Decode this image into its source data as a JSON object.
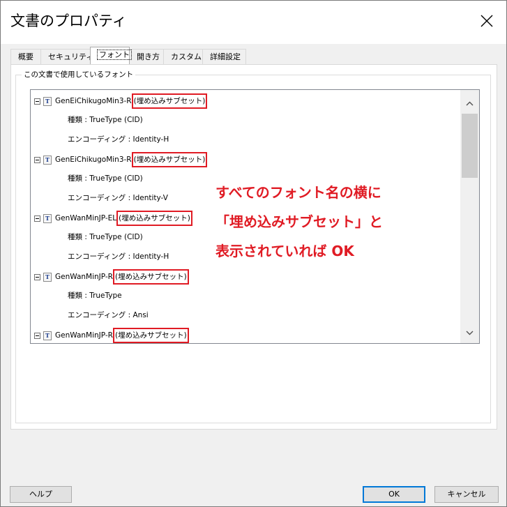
{
  "window": {
    "title": "文書のプロパティ"
  },
  "tabs": [
    {
      "label": "概要"
    },
    {
      "label": "セキュリティ"
    },
    {
      "label": "フォント",
      "active": true
    },
    {
      "label": "開き方"
    },
    {
      "label": "カスタム"
    },
    {
      "label": "詳細設定"
    }
  ],
  "group_label": "この文書で使用しているフォント",
  "fonts": [
    {
      "name": "GenEiChikugoMin3-R",
      "embed": "(埋め込みサブセット)",
      "type_label": "種類 : TrueType (CID)",
      "encoding_label": "エンコーディング : Identity-H"
    },
    {
      "name": "GenEiChikugoMin3-R",
      "embed": "(埋め込みサブセット)",
      "type_label": "種類 : TrueType (CID)",
      "encoding_label": "エンコーディング : Identity-V"
    },
    {
      "name": "GenWanMinJP-EL",
      "embed": "(埋め込みサブセット)",
      "type_label": "種類 : TrueType (CID)",
      "encoding_label": "エンコーディング : Identity-H"
    },
    {
      "name": "GenWanMinJP-R",
      "embed": "(埋め込みサブセット)",
      "type_label": "種類 : TrueType",
      "encoding_label": "エンコーディング : Ansi"
    },
    {
      "name": "GenWanMinJP-R",
      "embed": "(埋め込みサブセット)"
    }
  ],
  "annotation": {
    "line1": "すべてのフォント名の横に",
    "line2": "「埋め込みサブセット」と",
    "line3": "表示されていれば OK"
  },
  "buttons": {
    "help": "ヘルプ",
    "ok": "OK",
    "cancel": "キャンセル"
  },
  "colors": {
    "highlight": "#e01b24",
    "default_button_border": "#0078d7"
  },
  "icons": {
    "font_type": "truetype-font-icon",
    "collapse": "minus-icon"
  }
}
